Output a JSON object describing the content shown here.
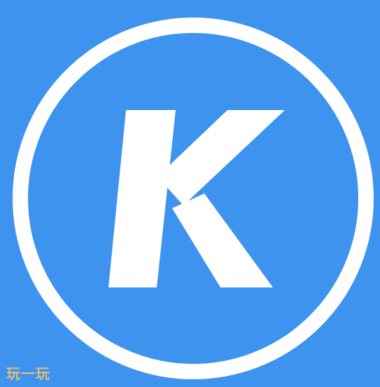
{
  "logo": {
    "letter": "K",
    "background_color": "#3d93ee",
    "foreground_color": "#ffffff"
  },
  "watermark": {
    "text": "玩一玩"
  }
}
